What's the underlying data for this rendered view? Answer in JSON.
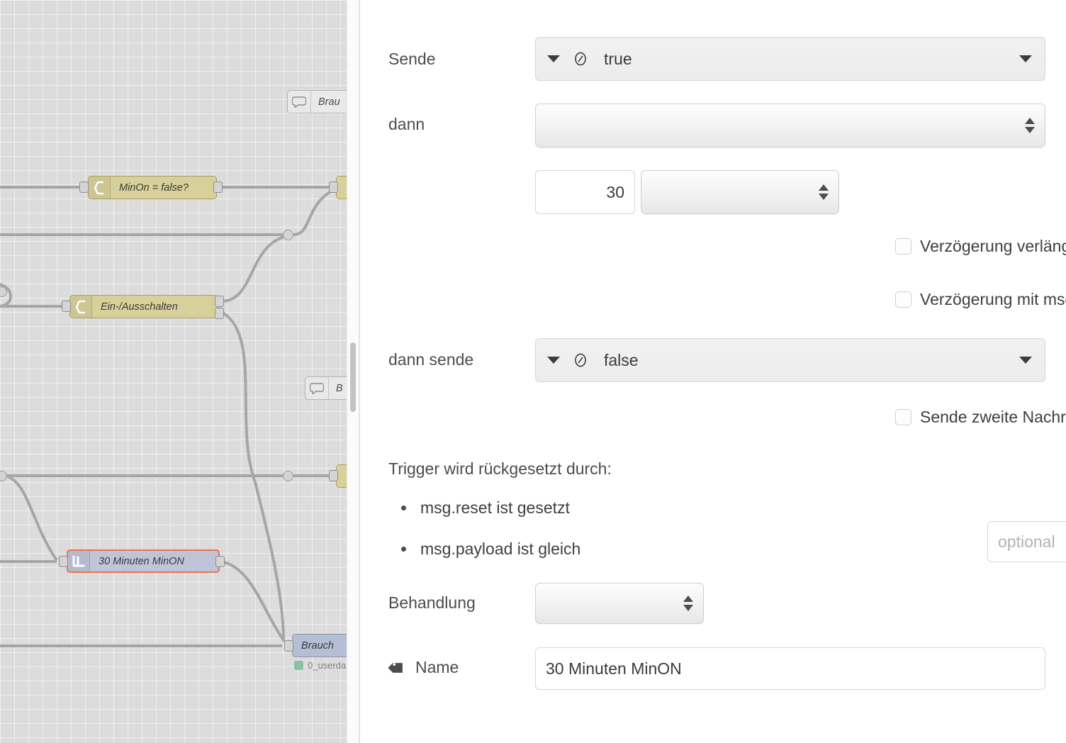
{
  "app": {
    "name": "Node-RED trigger node edit dialog"
  },
  "canvas": {
    "nodes": [
      {
        "id": "minon-false",
        "type": "switch",
        "label": "MinOn = false?"
      },
      {
        "id": "ein-aus",
        "type": "switch",
        "label": "Ein-/Ausschalten"
      },
      {
        "id": "trigger-30min",
        "type": "trigger",
        "label": "30 Minuten MinON",
        "selected": true
      },
      {
        "id": "brauch-bottom",
        "type": "link",
        "label": "Brauch"
      }
    ],
    "comments": [
      {
        "id": "comment-top",
        "label": "Brau"
      },
      {
        "id": "comment-mid",
        "label": "B"
      }
    ],
    "status": {
      "label": "0_userda",
      "dot_color": "#8cbfa8"
    },
    "colors": {
      "background": "#dcdcdc",
      "switch_node": "#d8d09a",
      "trigger_node": "#c0c4d8",
      "link_node": "#b4bed4",
      "selection_border": "#e8744a",
      "wire": "#a6a6a6"
    }
  },
  "form": {
    "send_label": "Sende",
    "send_value": "true",
    "send_type_icon": "boolean-icon",
    "then_label": "dann",
    "then_select_value": "",
    "duration_value": "30",
    "duration_unit_value": "",
    "extend_checkbox_label": "Verzögerung verlängern bei Eingang neuer Nachrichten",
    "extend_checked": false,
    "override_checkbox_label": "Verzögerung mit msg.delay überschreiben",
    "override_checked": false,
    "then_send_label": "dann sende",
    "then_send_value": "false",
    "then_send_type_icon": "boolean-icon",
    "second_output_checkbox_label": "Sende zweite Nachricht über separaten Ausgang",
    "second_output_checked": false,
    "reset_section_title": "Trigger wird rückgesetzt durch:",
    "reset_bullets": [
      "msg.reset ist gesetzt",
      "msg.payload ist gleich"
    ],
    "reset_payload_placeholder": "optional",
    "reset_payload_value": "",
    "handling_label": "Behandlung",
    "handling_value": "",
    "name_label": "Name",
    "name_icon": "tag-icon",
    "name_value": "30 Minuten MinON"
  }
}
